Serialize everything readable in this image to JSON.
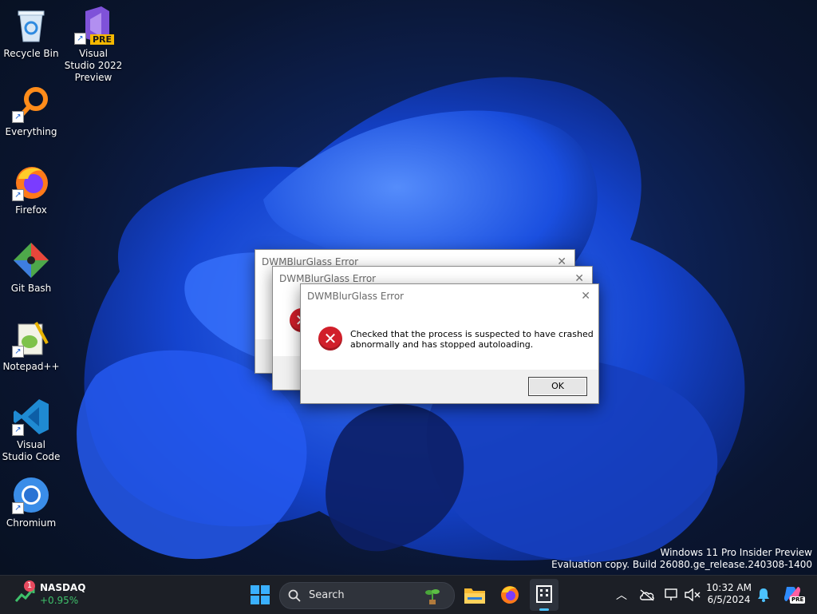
{
  "desktop": {
    "icons": [
      {
        "label": "Recycle Bin",
        "icon": "recycle-bin-icon"
      },
      {
        "label": "Visual Studio 2022 Preview",
        "icon": "visual-studio-preview-icon",
        "badge": "PRE"
      },
      {
        "label": "Everything",
        "icon": "everything-search-icon"
      },
      {
        "label": "Firefox",
        "icon": "firefox-icon"
      },
      {
        "label": "Git Bash",
        "icon": "git-bash-icon"
      },
      {
        "label": "Notepad++",
        "icon": "notepad-plus-plus-icon"
      },
      {
        "label": "Visual Studio Code",
        "icon": "vscode-icon"
      },
      {
        "label": "Chromium",
        "icon": "chromium-icon"
      }
    ]
  },
  "dialogs": [
    {
      "title": "DWMBlurGlass Error"
    },
    {
      "title": "DWMBlurGlass Error"
    },
    {
      "title": "DWMBlurGlass Error",
      "message_line1": "Checked that the process is suspected to have crashed",
      "message_line2": "abnormally and has stopped autoloading.",
      "ok_label": "OK"
    }
  ],
  "watermark": {
    "line1": "Windows 11 Pro Insider Preview",
    "line2": "Evaluation copy. Build 26080.ge_release.240308-1400"
  },
  "taskbar": {
    "widget": {
      "name": "NASDAQ",
      "change": "+0.95%",
      "badge": "1"
    },
    "search_placeholder": "Search",
    "time": "10:32 AM",
    "date": "6/5/2024",
    "copilot_badge": "PRE",
    "colors": {
      "accent": "#0078d4",
      "positive": "#3fc16b",
      "error": "#d11f2a"
    }
  }
}
